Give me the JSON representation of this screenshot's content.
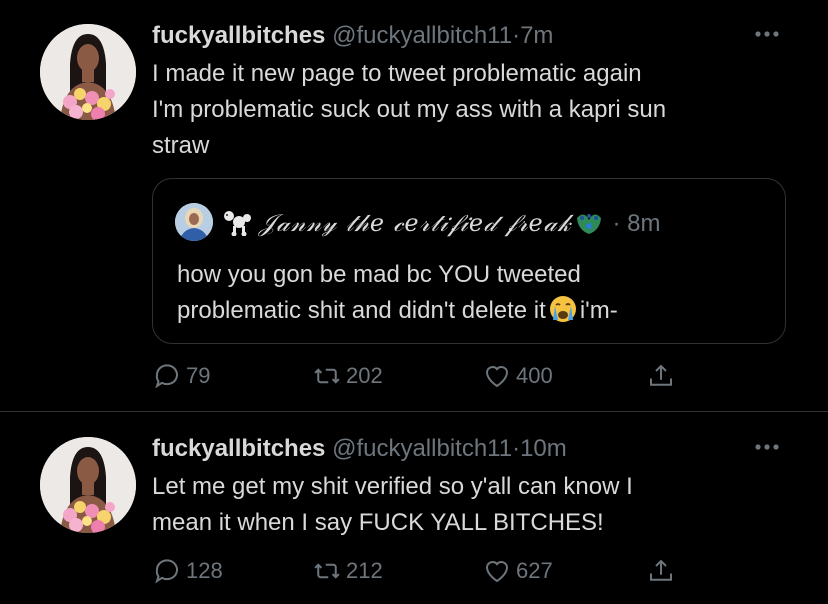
{
  "tweets": [
    {
      "display_name": "fuckyallbitches",
      "handle": "@fuckyallbitch11",
      "separator": "·",
      "time": "7m",
      "lines": [
        "I made it new page to tweet problematic again",
        "I'm problematic suck out my ass with a kapri sun",
        "straw"
      ],
      "quote": {
        "display_name": "𝒥𝒶𝓃𝓃𝓎 𝓉𝒽𝑒 𝒸𝑒𝓇𝓉𝒾𝒻𝒾𝑒𝒹 𝒻𝓇𝑒𝒶𝓀",
        "separator": "·",
        "time": "8m",
        "line1": "how you gon be mad bc YOU tweeted",
        "line2_before_emoji": "problematic shit and didn't delete it",
        "line2_after_emoji": "i'm-"
      },
      "actions": {
        "replies": "79",
        "retweets": "202",
        "likes": "400"
      }
    },
    {
      "display_name": "fuckyallbitches",
      "handle": "@fuckyallbitch11",
      "separator": "·",
      "time": "10m",
      "lines": [
        "Let me get my shit verified so y'all can know I",
        "mean it when I say FUCK YALL BITCHES!"
      ],
      "actions": {
        "replies": "128",
        "retweets": "212",
        "likes": "627"
      }
    }
  ],
  "icons": {
    "reply": "reply-icon",
    "retweet": "retweet-icon",
    "like": "heart-icon",
    "share": "share-icon",
    "more": "more-icon",
    "poodle_emoji": "poodle-icon",
    "peacock_emoji": "peacock-icon",
    "crying_emoji": "crying-face-icon"
  },
  "colors": {
    "background": "#000000",
    "text": "#d9d9d9",
    "muted": "#6e767d",
    "border": "#2f3336"
  }
}
